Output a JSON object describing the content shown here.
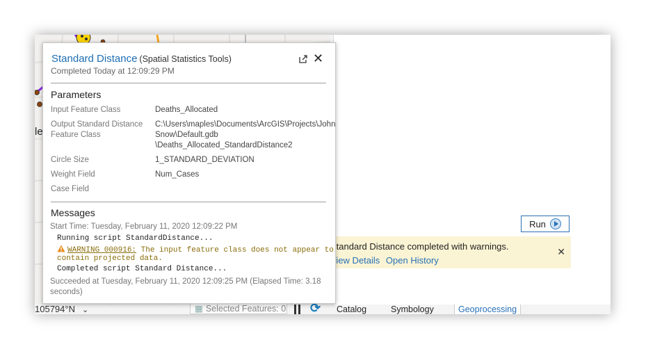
{
  "popup": {
    "title": "Standard Distance",
    "subtitle": "(Spatial Statistics Tools)",
    "completed": "Completed Today at 12:09:29 PM",
    "parameters_heading": "Parameters",
    "parameters": [
      {
        "label": "Input Feature Class",
        "value": "Deaths_Allocated"
      },
      {
        "label": "Output Standard Distance Feature Class",
        "value": "C:\\Users\\maples\\Documents\\ArcGIS\\Projects\\John Snow\\Default.gdb \\Deaths_Allocated_StandardDistance2"
      },
      {
        "label": "Circle Size",
        "value": "1_STANDARD_DEVIATION"
      },
      {
        "label": "Weight Field",
        "value": "Num_Cases"
      },
      {
        "label": "Case Field",
        "value": ""
      }
    ],
    "messages_heading": "Messages",
    "start_time": "Start Time: Tuesday, February 11, 2020 12:09:22 PM",
    "msg_running": "Running script StandardDistance...",
    "msg_warning_code": "WARNING 000916:",
    "msg_warning_text_1": " The input feature class does not appear to",
    "msg_warning_text_2": "contain projected data.",
    "msg_completed": "Completed script Standard Distance...",
    "succeeded": "Succeeded at Tuesday, February 11, 2020 12:09:25 PM (Elapsed Time: 3.18 seconds)"
  },
  "map": {
    "partial_label": "le",
    "coordinate": "105794°N"
  },
  "status": {
    "selected_features": "Selected Features: 0"
  },
  "run_label": "Run",
  "banner": {
    "message": "Standard Distance completed with warnings.",
    "view_details": "View Details",
    "open_history": "Open History"
  },
  "tabs": [
    {
      "label": "Catalog"
    },
    {
      "label": "Symbology"
    },
    {
      "label": "Geoprocessing"
    }
  ],
  "colors": {
    "accent": "#1c6db3",
    "warning_bg": "#fbf4d4",
    "warning_icon": "#e8891c"
  }
}
